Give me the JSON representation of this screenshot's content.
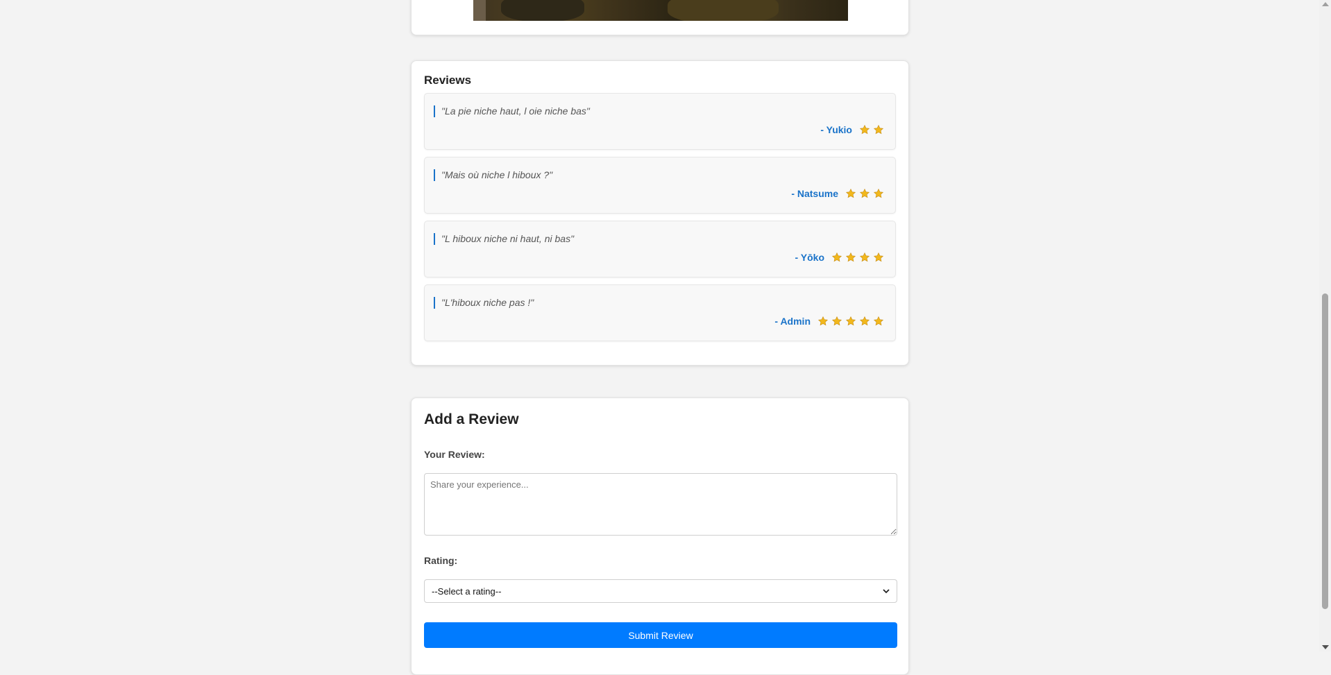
{
  "reviews_section": {
    "title": "Reviews",
    "items": [
      {
        "quote": "\"La pie niche haut, l oie niche bas\"",
        "author": "- Yukio",
        "rating": 2
      },
      {
        "quote": "\"Mais où niche l hiboux ?\"",
        "author": "- Natsume",
        "rating": 3
      },
      {
        "quote": "\"L hiboux niche ni haut, ni bas\"",
        "author": "- Yōko",
        "rating": 4
      },
      {
        "quote": "\"L'hiboux niche pas !\"",
        "author": "- Admin",
        "rating": 5
      }
    ]
  },
  "form": {
    "title": "Add a Review",
    "review_label": "Your Review:",
    "review_placeholder": "Share your experience...",
    "rating_label": "Rating:",
    "rating_selected": "--Select a rating--",
    "submit_label": "Submit Review"
  },
  "colors": {
    "accent": "#1a73c9",
    "button": "#007bff",
    "star": "#f2b81c"
  }
}
